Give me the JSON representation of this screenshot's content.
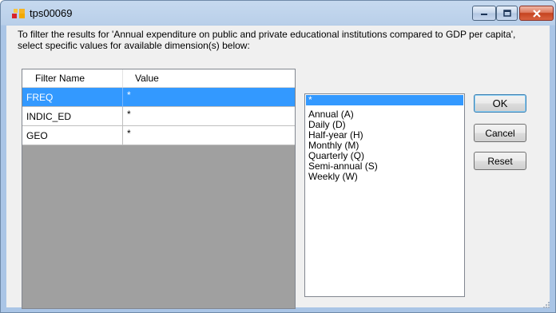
{
  "window": {
    "title": "tps00069",
    "controls": {
      "minimize": "minimize",
      "maximize": "maximize",
      "close": "close"
    }
  },
  "instructions": "To filter the results for 'Annual expenditure on public and private educational institutions compared to GDP per capita', select specific values for available dimension(s) below:",
  "grid": {
    "columns": [
      "Filter Name",
      "Value"
    ],
    "rows": [
      {
        "name": "FREQ",
        "value": "*",
        "selected": true
      },
      {
        "name": "INDIC_ED",
        "value": "*",
        "selected": false
      },
      {
        "name": "GEO",
        "value": "*",
        "selected": false
      }
    ]
  },
  "values_list": {
    "items": [
      "*",
      "Annual (A)",
      "Daily (D)",
      "Half-year (H)",
      "Monthly (M)",
      "Quarterly (Q)",
      "Semi-annual (S)",
      "Weekly (W)"
    ],
    "selected": "*"
  },
  "buttons": {
    "ok": "OK",
    "cancel": "Cancel",
    "reset": "Reset"
  },
  "colors": {
    "selection": "#3399ff",
    "grid_background": "#a0a0a0",
    "title_bar": "#b9cfe9"
  }
}
